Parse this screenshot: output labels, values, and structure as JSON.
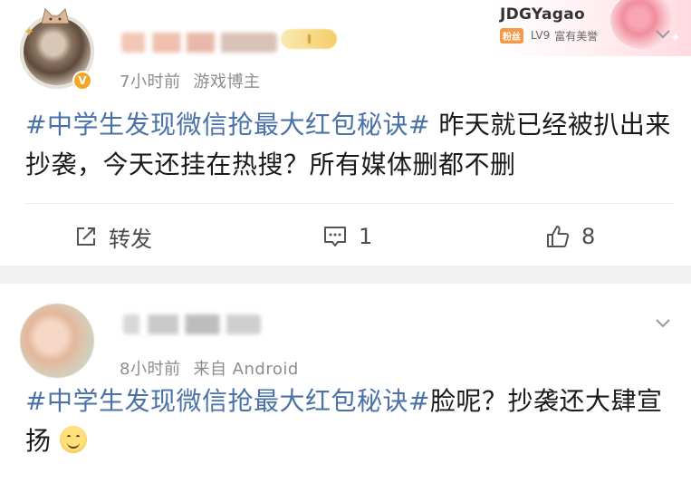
{
  "posts": [
    {
      "meta": {
        "time": "7小时前",
        "source": "游戏博主"
      },
      "content": {
        "topic": "#中学生发现微信抢最大红包秘诀#",
        "text": " 昨天就已经被扒出来抄袭，今天还挂在热搜？所有媒体删都不删"
      },
      "actions": {
        "repost_label": "转发",
        "comment_count": "1",
        "like_count": "8"
      }
    },
    {
      "meta": {
        "time": "8小时前",
        "source": "来自 Android"
      },
      "content": {
        "topic": "#中学生发现微信抢最大红包秘诀#",
        "text": "脸呢？抄袭还大肆宣扬"
      }
    }
  ],
  "recommend_card": {
    "name": "JDGYagao",
    "level_tag": "LV9",
    "level_text": "富有美誉",
    "prefix_tag": "粉丝"
  },
  "icons": {
    "verified": "verified-v-icon",
    "repost": "repost-icon",
    "comment": "comment-icon",
    "like": "thumb-up-icon",
    "more": "chevron-down-icon"
  },
  "colors": {
    "topic": "#4a72a8",
    "meta": "#8d8d8d",
    "verified_badge": "#f4a623"
  }
}
